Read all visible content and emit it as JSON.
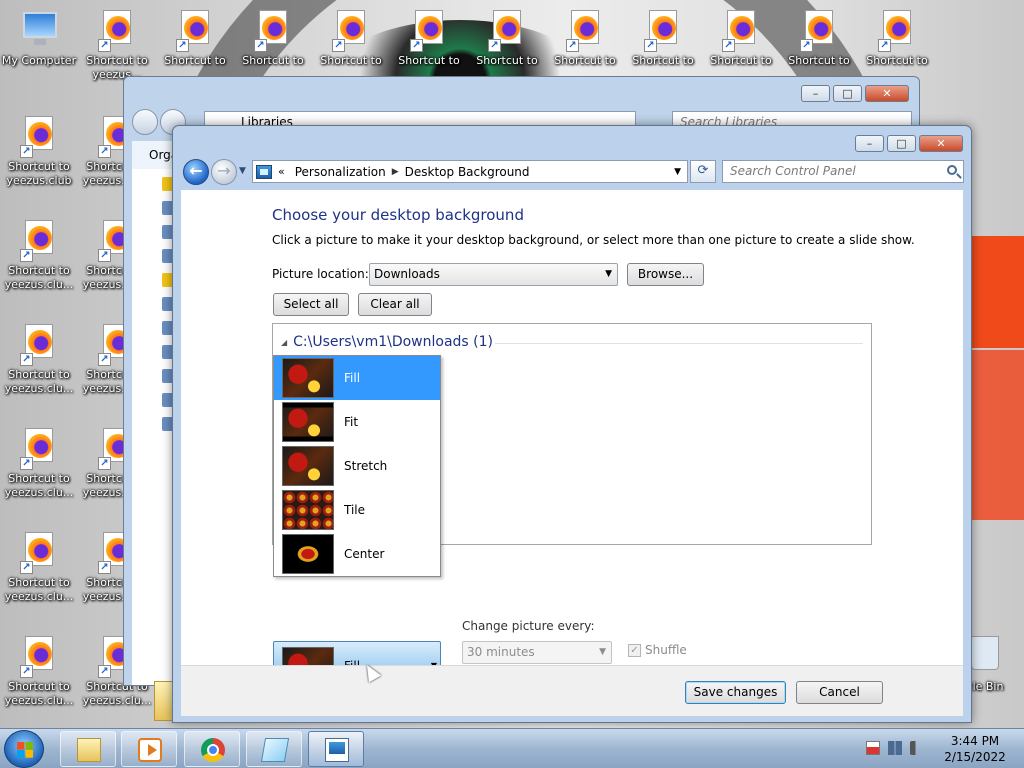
{
  "desktop": {
    "icons": [
      {
        "label": "My Computer"
      },
      {
        "label": "Shortcut to yeezus..."
      },
      {
        "label": "Shortcut to"
      },
      {
        "label": "Shortcut to"
      },
      {
        "label": "Shortcut to"
      },
      {
        "label": "Shortcut to"
      },
      {
        "label": "Shortcut to"
      },
      {
        "label": "Shortcut to"
      },
      {
        "label": "Shortcut to"
      },
      {
        "label": "Shortcut to"
      },
      {
        "label": "Shortcut to"
      },
      {
        "label": "Shortcut to"
      },
      {
        "label": "Shortcut to yeezus.club"
      },
      {
        "label": "Shortcut to yeezus.clu..."
      },
      {
        "label": "Shortcut to yeezus.clu..."
      },
      {
        "label": "Shortcut to yeezus.clu..."
      },
      {
        "label": "Shortcut to yeezus.clu..."
      },
      {
        "label": "Shortcut to yeezus.clu..."
      },
      {
        "label": "Shortcut to yeezus.clu..."
      },
      {
        "label": "Shortcut to yeezus.clu..."
      },
      {
        "label": "Shortcut to yeezus.clu..."
      },
      {
        "label": "Shortcut to yeezus.clu..."
      },
      {
        "label": "Shortcut to yeezus.clu..."
      },
      {
        "label": "Shortcut to yeezus.clu..."
      }
    ],
    "recycle_label": "cle Bin"
  },
  "back_window": {
    "address": "Libraries",
    "search_placeholder": "Search Libraries",
    "organize_label": "Orga"
  },
  "window": {
    "breadcrumb": [
      "Personalization",
      "Desktop Background"
    ],
    "search_placeholder": "Search Control Panel",
    "title": "Choose your desktop background",
    "description": "Click a picture to make it your desktop background, or select more than one picture to create a slide show.",
    "picture_location_label": "Picture location:",
    "picture_location_value": "Downloads",
    "browse_label": "Browse...",
    "select_all_label": "Select all",
    "clear_all_label": "Clear all",
    "group_label": "C:\\Users\\vm1\\Downloads (1)",
    "position_options": [
      "Fill",
      "Fit",
      "Stretch",
      "Tile",
      "Center"
    ],
    "position_selected": "Fill",
    "change_picture_label": "Change picture every:",
    "change_picture_value": "30 minutes",
    "shuffle_label": "Shuffle",
    "save_label": "Save changes",
    "cancel_label": "Cancel"
  },
  "taskbar": {
    "time": "3:44 PM",
    "date": "2/15/2022"
  }
}
